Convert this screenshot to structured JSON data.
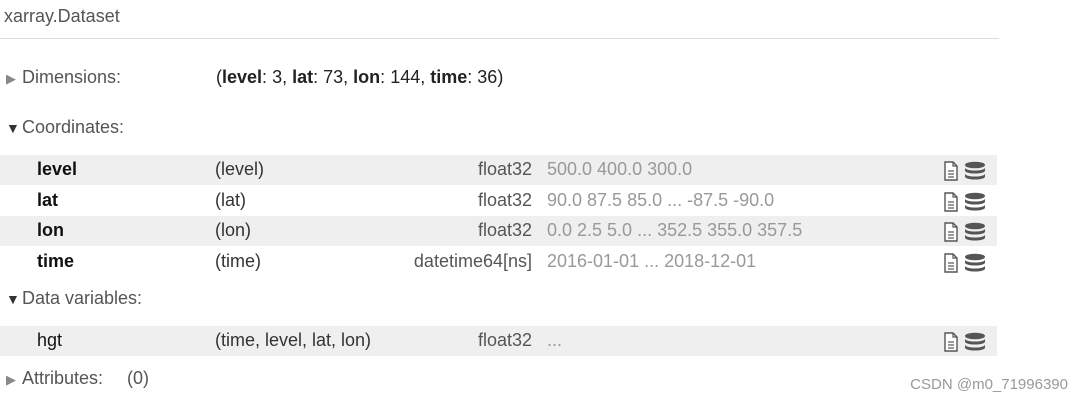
{
  "header": {
    "title": "xarray.Dataset"
  },
  "dimensions": {
    "label": "Dimensions:",
    "open": "(",
    "close": ")",
    "items": [
      {
        "name": "level",
        "value": "3"
      },
      {
        "name": "lat",
        "value": "73"
      },
      {
        "name": "lon",
        "value": "144"
      },
      {
        "name": "time",
        "value": "36"
      }
    ]
  },
  "coordinates": {
    "label": "Coordinates:",
    "rows": [
      {
        "name": "level",
        "dims": "(level)",
        "dtype": "float32",
        "preview": "500.0 400.0 300.0"
      },
      {
        "name": "lat",
        "dims": "(lat)",
        "dtype": "float32",
        "preview": "90.0 87.5 85.0 ... -87.5 -90.0"
      },
      {
        "name": "lon",
        "dims": "(lon)",
        "dtype": "float32",
        "preview": "0.0 2.5 5.0 ... 352.5 355.0 357.5"
      },
      {
        "name": "time",
        "dims": "(time)",
        "dtype": "datetime64[ns]",
        "preview": "2016-01-01 ... 2018-12-01"
      }
    ]
  },
  "data_variables": {
    "label": "Data variables:",
    "rows": [
      {
        "name": "hgt",
        "dims": "(time, level, lat, lon)",
        "dtype": "float32",
        "preview": "..."
      }
    ]
  },
  "attributes": {
    "label": "Attributes:",
    "count": "(0)"
  },
  "icons": {
    "attrs": "file-icon",
    "data": "database-icon"
  },
  "watermark": "CSDN @m0_71996390"
}
